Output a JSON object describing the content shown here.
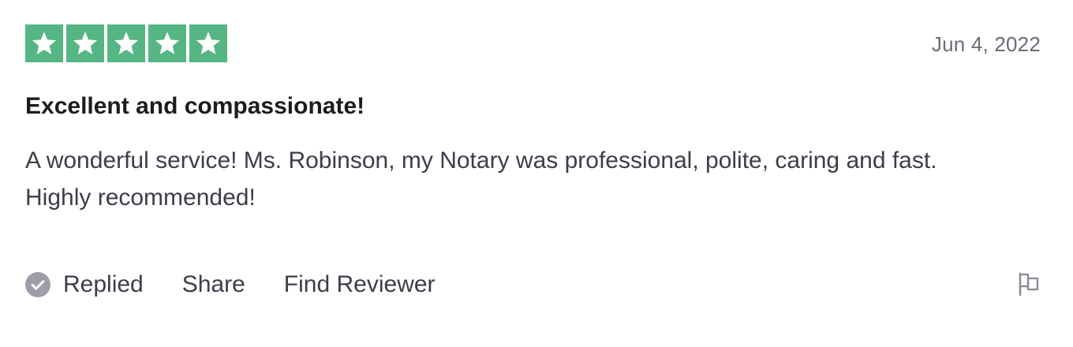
{
  "review": {
    "rating": 5,
    "rating_max": 5,
    "star_color": "#55b683",
    "date": "Jun 4, 2022",
    "title": "Excellent and compassionate!",
    "body": "A wonderful service! Ms. Robinson, my Notary was professional, polite, caring and fast. Highly recommended!"
  },
  "actions": {
    "replied_label": "Replied",
    "replied_icon": "check-circle-icon",
    "share_label": "Share",
    "find_reviewer_label": "Find Reviewer",
    "flag_icon": "flag-icon"
  }
}
